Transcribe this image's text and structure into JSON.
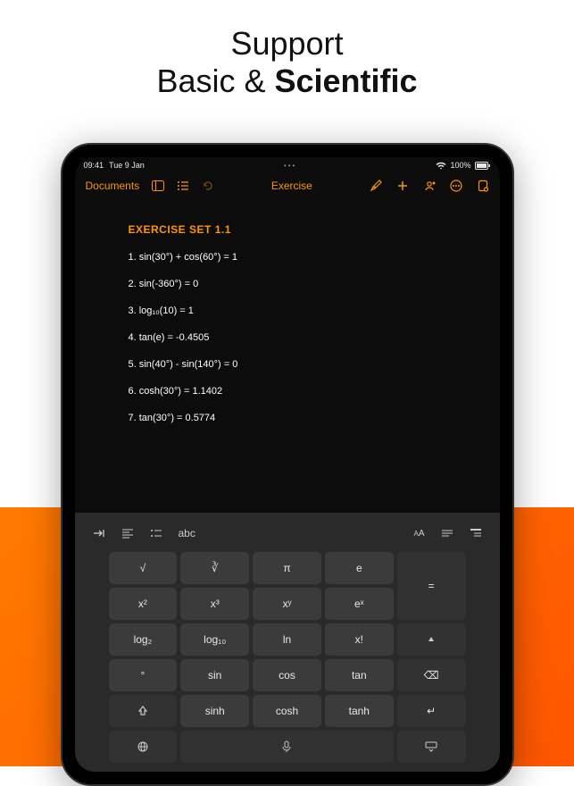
{
  "headline": {
    "line1": "Support",
    "line2_a": "Basic & ",
    "line2_b": "Scientific"
  },
  "status": {
    "time": "09:41",
    "date": "Tue 9 Jan",
    "battery": "100%"
  },
  "toolbar": {
    "documents": "Documents",
    "title": "Exercise"
  },
  "content": {
    "heading": "EXERCISE SET 1.1",
    "items": [
      "1.  sin(30°) + cos(60°) = 1",
      "2.  sin(-360°) = 0",
      "3.  log₁₀(10) = 1",
      "4.  tan(e) = -0.4505",
      "5.  sin(40°) - sin(140°) = 0",
      "6.  cosh(30°) = 1.1402",
      "7.  tan(30°) = 0.5774"
    ]
  },
  "kb_toolbar": {
    "abc": "abc",
    "aa": "AA"
  },
  "keys": {
    "r0": [
      "√",
      "∛",
      "π",
      "e"
    ],
    "eq": "=",
    "r1": [
      "x²",
      "x³",
      "xʸ",
      "eˣ"
    ],
    "r2": [
      "log₂",
      "log₁₀",
      "ln",
      "x!"
    ],
    "r3": [
      "°",
      "sin",
      "cos",
      "tan"
    ],
    "del": "⌫",
    "r4": [
      "sinh",
      "cosh",
      "tanh"
    ],
    "enter": "↵"
  }
}
